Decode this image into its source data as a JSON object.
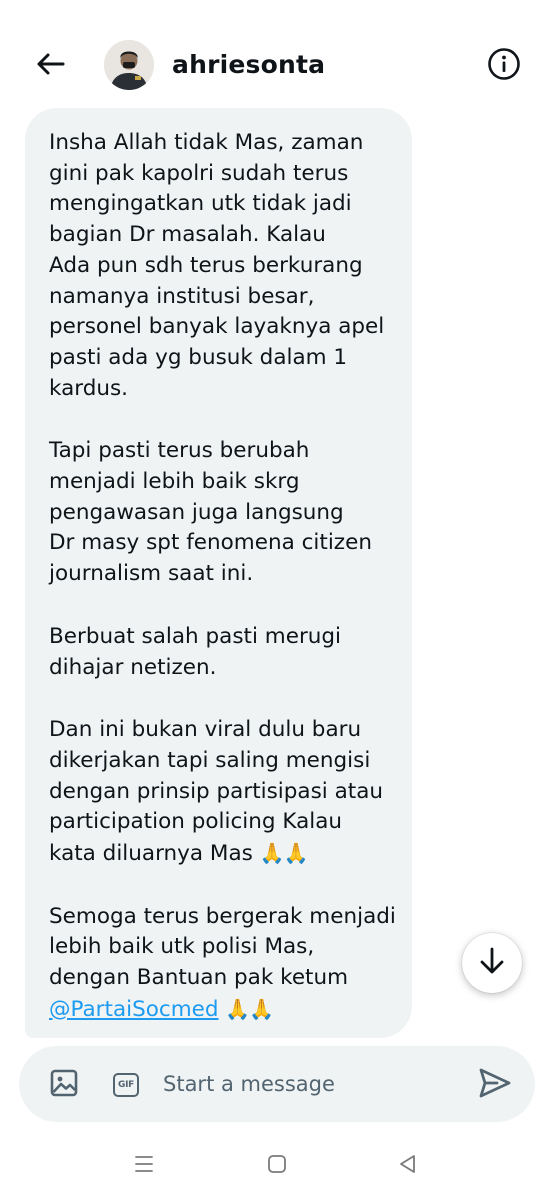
{
  "header": {
    "username": "ahriesonta"
  },
  "conversation": {
    "message": {
      "paragraphs": [
        "Insha Allah tidak Mas, zaman\ngini pak kapolri sudah terus\nmengingatkan utk tidak jadi\nbagian Dr masalah. Kalau\nAda pun sdh terus berkurang\nnamanya institusi besar,\npersonel banyak layaknya apel\npasti ada yg busuk dalam 1\nkardus.",
        "Tapi pasti terus berubah\nmenjadi lebih baik skrg\npengawasan juga langsung\nDr masy spt fenomena citizen\njournalism saat ini.",
        "Berbuat salah pasti merugi\ndihajar netizen.",
        "Dan ini bukan viral dulu baru\ndikerjakan tapi saling mengisi\ndengan prinsip partisipasi atau\nparticipation policing Kalau\nkata diluarnya Mas",
        "Semoga terus bergerak menjadi\nlebih baik utk polisi Mas,\ndengan Bantuan pak ketum"
      ],
      "emoji": "🙏🙏",
      "mention": "@PartaiSocmed"
    }
  },
  "composer": {
    "gif_label": "GIF",
    "placeholder": "Start a message"
  },
  "colors": {
    "bubble_bg": "#eff3f4",
    "text": "#0f1419",
    "secondary": "#536471",
    "link": "#1d9bf0"
  },
  "icons": {
    "back": "arrow-left-icon",
    "info": "info-icon",
    "scroll": "arrow-down-icon",
    "image": "image-icon",
    "gif": "gif-icon",
    "send": "send-icon",
    "nav_recents": "recents-icon",
    "nav_home": "home-icon",
    "nav_back": "back-triangle-icon"
  }
}
